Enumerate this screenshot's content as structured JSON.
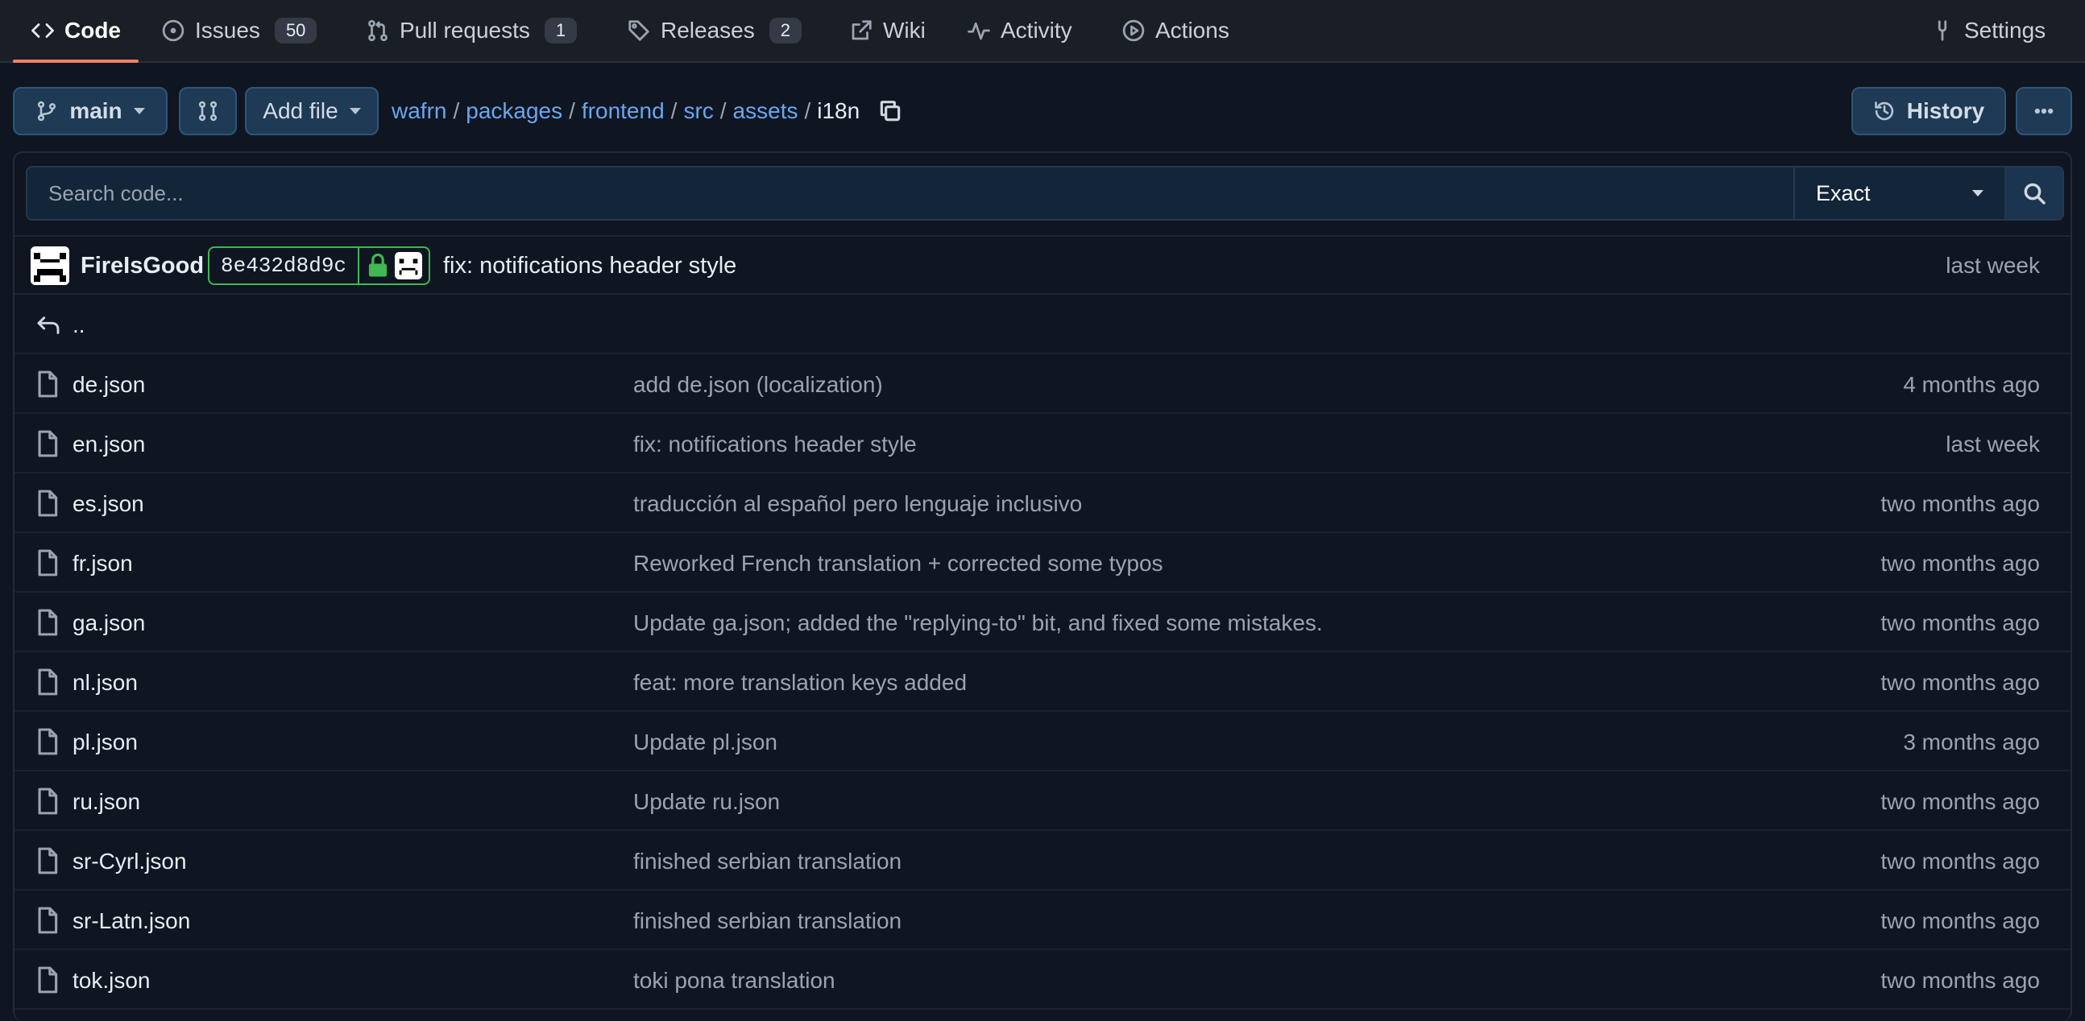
{
  "nav": {
    "tabs": [
      {
        "label": "Code",
        "icon": "code-icon"
      },
      {
        "label": "Issues",
        "count": "50",
        "icon": "issue-icon"
      },
      {
        "label": "Pull requests",
        "count": "1",
        "icon": "pull-request-icon"
      },
      {
        "label": "Releases",
        "count": "2",
        "icon": "tag-icon"
      },
      {
        "label": "Wiki",
        "icon": "external-link-icon"
      },
      {
        "label": "Activity",
        "icon": "pulse-icon"
      },
      {
        "label": "Actions",
        "icon": "play-icon"
      }
    ],
    "settings_label": "Settings",
    "accent_color": "#f78166"
  },
  "toolbar": {
    "branch": "main",
    "add_file_label": "Add file",
    "history_label": "History",
    "breadcrumb": [
      "wafrn",
      "packages",
      "frontend",
      "src",
      "assets"
    ],
    "current_dir": "i18n"
  },
  "search": {
    "placeholder": "Search code...",
    "mode": "Exact"
  },
  "latest_commit": {
    "author": "FireIsGood",
    "sha": "8e432d8d9c",
    "message": "fix: notifications header style",
    "time": "last week",
    "verified_color": "#3fb950"
  },
  "parent_dir_label": "..",
  "files": [
    {
      "name": "de.json",
      "message": "add de.json (localization)",
      "time": "4 months ago"
    },
    {
      "name": "en.json",
      "message": "fix: notifications header style",
      "time": "last week"
    },
    {
      "name": "es.json",
      "message": "traducción al español pero lenguaje inclusivo",
      "time": "two months ago"
    },
    {
      "name": "fr.json",
      "message": "Reworked French translation + corrected some typos",
      "time": "two months ago"
    },
    {
      "name": "ga.json",
      "message": "Update ga.json; added the \"replying-to\" bit, and fixed some mistakes.",
      "time": "two months ago"
    },
    {
      "name": "nl.json",
      "message": "feat: more translation keys added",
      "time": "two months ago"
    },
    {
      "name": "pl.json",
      "message": "Update pl.json",
      "time": "3 months ago"
    },
    {
      "name": "ru.json",
      "message": "Update ru.json",
      "time": "two months ago"
    },
    {
      "name": "sr-Cyrl.json",
      "message": "finished serbian translation",
      "time": "two months ago"
    },
    {
      "name": "sr-Latn.json",
      "message": "finished serbian translation",
      "time": "two months ago"
    },
    {
      "name": "tok.json",
      "message": "toki pona translation",
      "time": "two months ago"
    }
  ]
}
